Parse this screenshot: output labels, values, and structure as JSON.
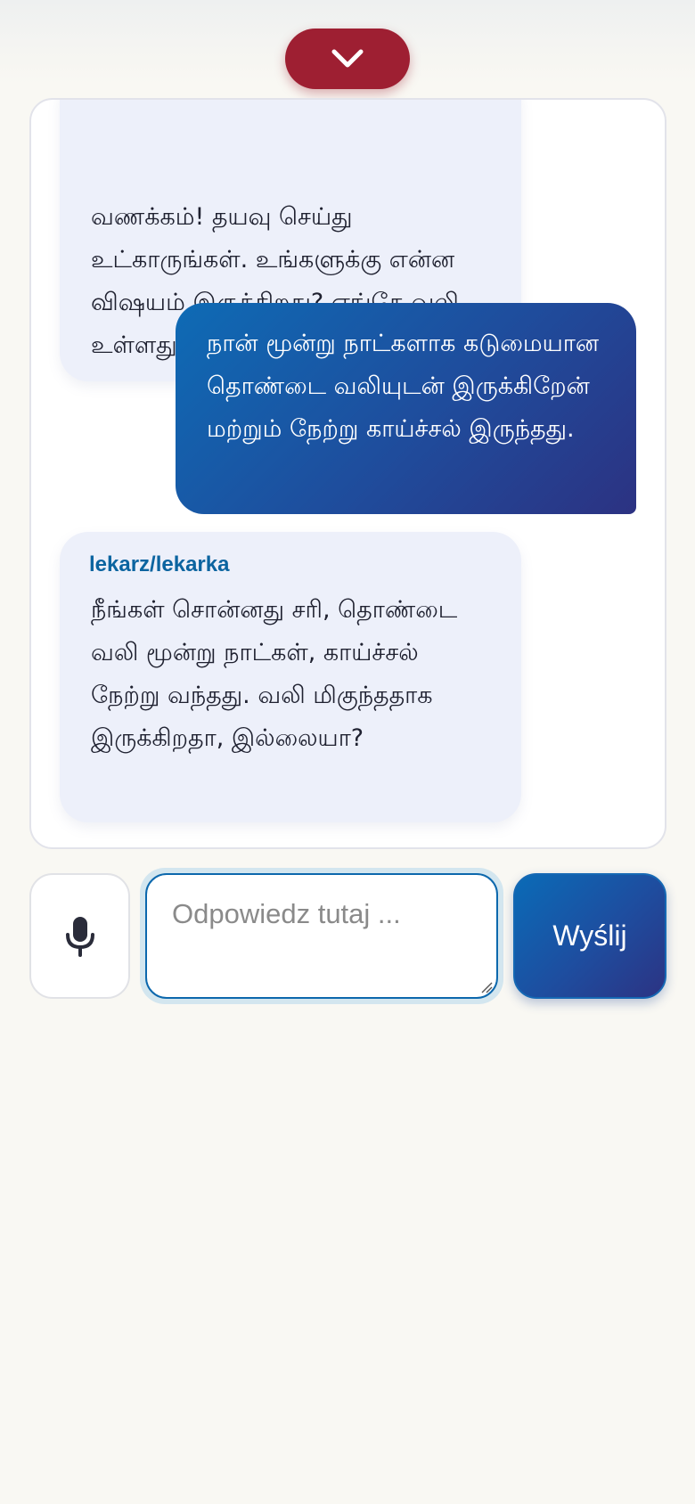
{
  "header": {
    "collapse_icon": "chevron-down-icon",
    "collapse_color": "#9e1f32"
  },
  "messages": [
    {
      "role": "doctor",
      "sender": "",
      "text": "வணக்கம்! தயவு செய்து உட்காருங்கள். உங்களுக்கு என்ன விஷயம் இருக்கிறது? எங்கே வலி உள்ளது?"
    },
    {
      "role": "patient",
      "text": "நான் மூன்று நாட்களாக கடுமையான தொண்டை வலியுடன் இருக்கிறேன் மற்றும் நேற்று காய்ச்சல் இருந்தது."
    },
    {
      "role": "doctor",
      "sender": "lekarz/lekarka",
      "text": "நீங்கள் சொன்னது சரி, தொண்டை வலி மூன்று நாட்கள், காய்ச்சல் நேற்று வந்தது. வலி மிகுந்ததாக இருக்கிறதா, இல்லையா?"
    }
  ],
  "composer": {
    "mic_icon": "microphone-icon",
    "placeholder": "Odpowiedz tutaj ...",
    "value": "",
    "send_label": "Wyślij"
  },
  "colors": {
    "accent_blue": "#0c68ad",
    "bot_bubble": "#edf0fa",
    "user_bubble_start": "#0e6bb5",
    "user_bubble_end": "#2c3282",
    "page_bg": "#f9f8f3"
  }
}
